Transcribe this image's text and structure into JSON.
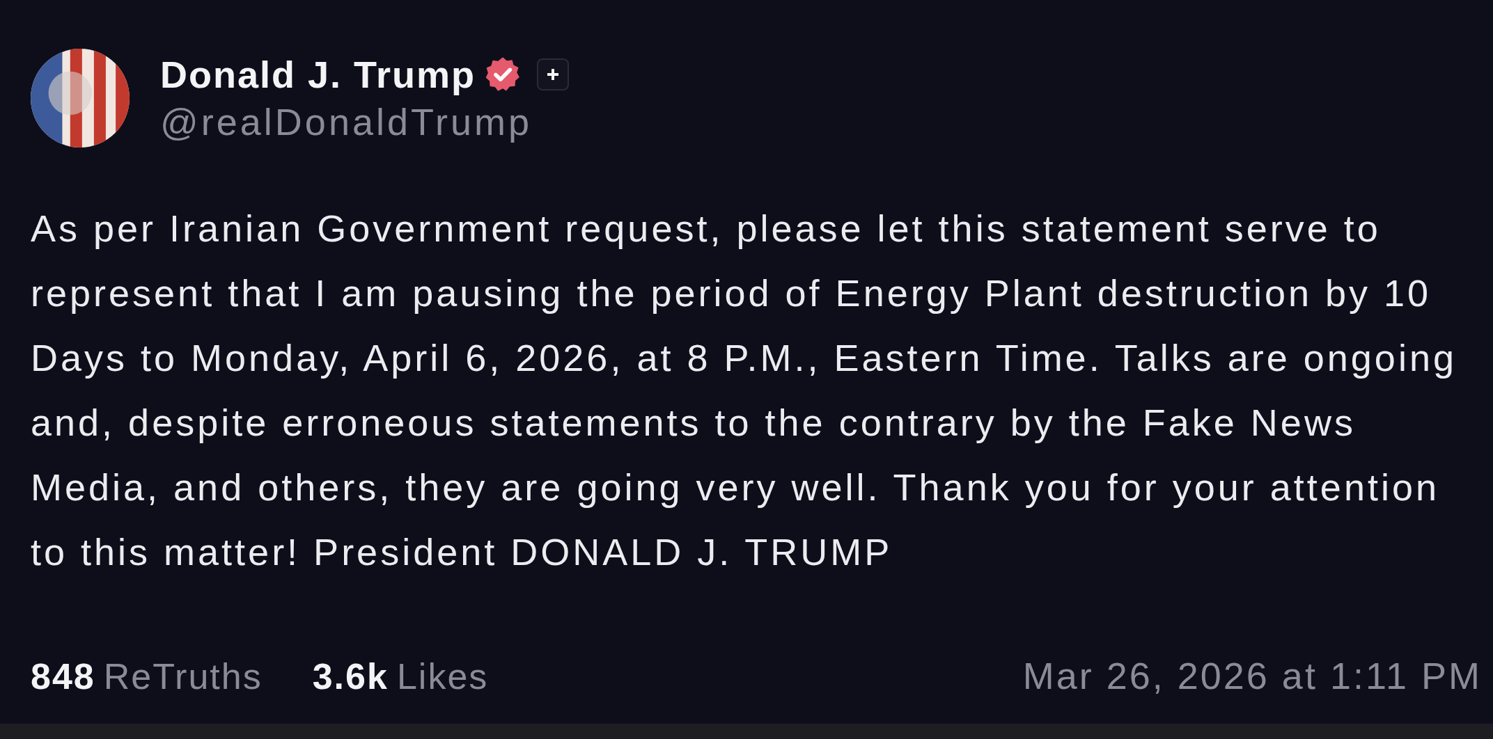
{
  "author": {
    "name": "Donald J. Trump",
    "verified": true,
    "handle": "@realDonaldTrump"
  },
  "post": {
    "text": "As per Iranian Government request, please let this statement serve to represent that I am pausing the period of Energy Plant destruction by 10 Days to Monday, April 6, 2026, at 8 P.M., Eastern Time. Talks are ongoing and, despite erroneous statements to the contrary by the Fake News Media, and others, they are going very well. Thank you for your attention to this matter! President DONALD J. TRUMP"
  },
  "stats": [
    {
      "count": "848",
      "unit": "ReTruths"
    },
    {
      "count": "3.6k",
      "unit": "Likes"
    }
  ],
  "timestamp": "Mar 26, 2026 at 1:11 PM"
}
